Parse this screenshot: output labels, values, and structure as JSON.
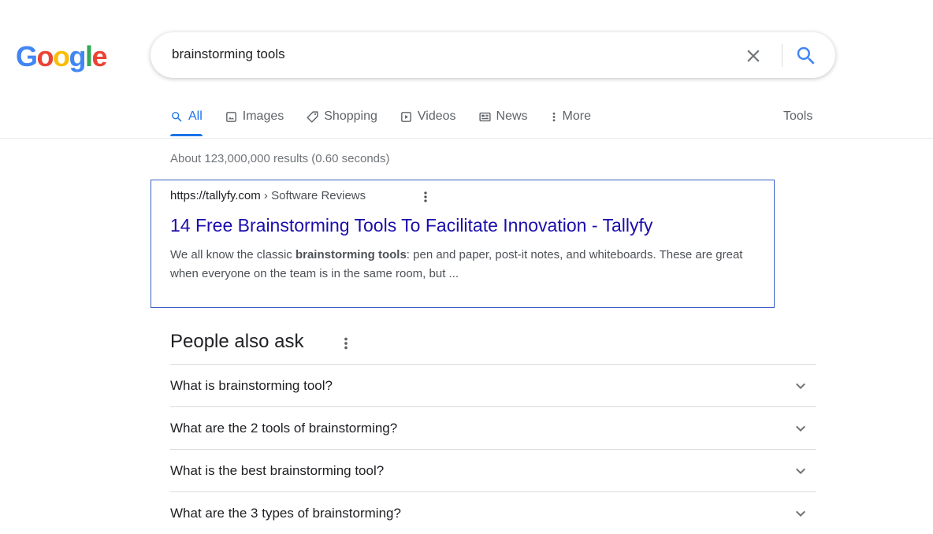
{
  "logo": {
    "text": "Google",
    "letters": [
      {
        "ch": "G",
        "color": "#4285F4"
      },
      {
        "ch": "o",
        "color": "#EA4335"
      },
      {
        "ch": "o",
        "color": "#FBBC05"
      },
      {
        "ch": "g",
        "color": "#4285F4"
      },
      {
        "ch": "l",
        "color": "#34A853"
      },
      {
        "ch": "e",
        "color": "#EA4335"
      }
    ]
  },
  "search": {
    "query": "brainstorming tools",
    "clear_icon": "close-icon",
    "search_icon": "search-icon"
  },
  "tabs": [
    {
      "label": "All",
      "icon": "search-icon",
      "active": true
    },
    {
      "label": "Images",
      "icon": "image-icon"
    },
    {
      "label": "Shopping",
      "icon": "tag-icon"
    },
    {
      "label": "Videos",
      "icon": "play-icon"
    },
    {
      "label": "News",
      "icon": "newspaper-icon"
    },
    {
      "label": "More",
      "icon": "more-vert-icon"
    }
  ],
  "tools_label": "Tools",
  "stats": "About 123,000,000 results (0.60 seconds)",
  "result": {
    "site": "https://tallyfy.com",
    "crumb": " › Software Reviews",
    "title": "14 Free Brainstorming Tools To Facilitate Innovation - Tallyfy",
    "snippet_pre": "We all know the classic ",
    "snippet_bold": "brainstorming tools",
    "snippet_post": ": pen and paper, post-it notes, and whiteboards. These are great when everyone on the team is in the same room, but ..."
  },
  "paa": {
    "title": "People also ask",
    "questions": [
      "What is brainstorming tool?",
      "What are the 2 tools of brainstorming?",
      "What is the best brainstorming tool?",
      "What are the 3 types of brainstorming?"
    ]
  },
  "colors": {
    "accent": "#1a73e8",
    "link": "#1a0dab"
  }
}
